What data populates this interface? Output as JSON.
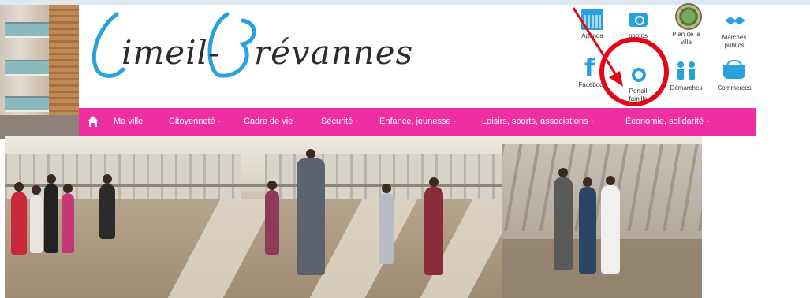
{
  "logo": {
    "text_line1": "imeil-",
    "text_line2": "révannes"
  },
  "quick_links": [
    {
      "label": "Agenda",
      "icon": "calendar-icon"
    },
    {
      "label": "photos",
      "icon": "camera-icon"
    },
    {
      "label": "Plan de la ville",
      "icon": "map-icon"
    },
    {
      "label": "Marchés publics",
      "icon": "handshake-icon"
    },
    {
      "label": "Facebook",
      "icon": "facebook-icon"
    },
    {
      "label": "Portail famille",
      "icon": "portal-icon"
    },
    {
      "label": "Démarches",
      "icon": "people-icon"
    },
    {
      "label": "Commerces",
      "icon": "basket-icon"
    }
  ],
  "nav": {
    "home_icon": "home-icon",
    "items": [
      "Ma ville",
      "Citoyenneté",
      "Cadre de vie",
      "Sécurité",
      "Enfance, jeunesse",
      "Loisirs, sports, associations",
      "Économie, solidarité"
    ],
    "caret": "·"
  },
  "annotation": {
    "highlight_color": "#e30613"
  },
  "colors": {
    "nav_bg": "#ee2fa2",
    "icon_blue": "#29a1dc",
    "logo_blue": "#29a1dc"
  }
}
